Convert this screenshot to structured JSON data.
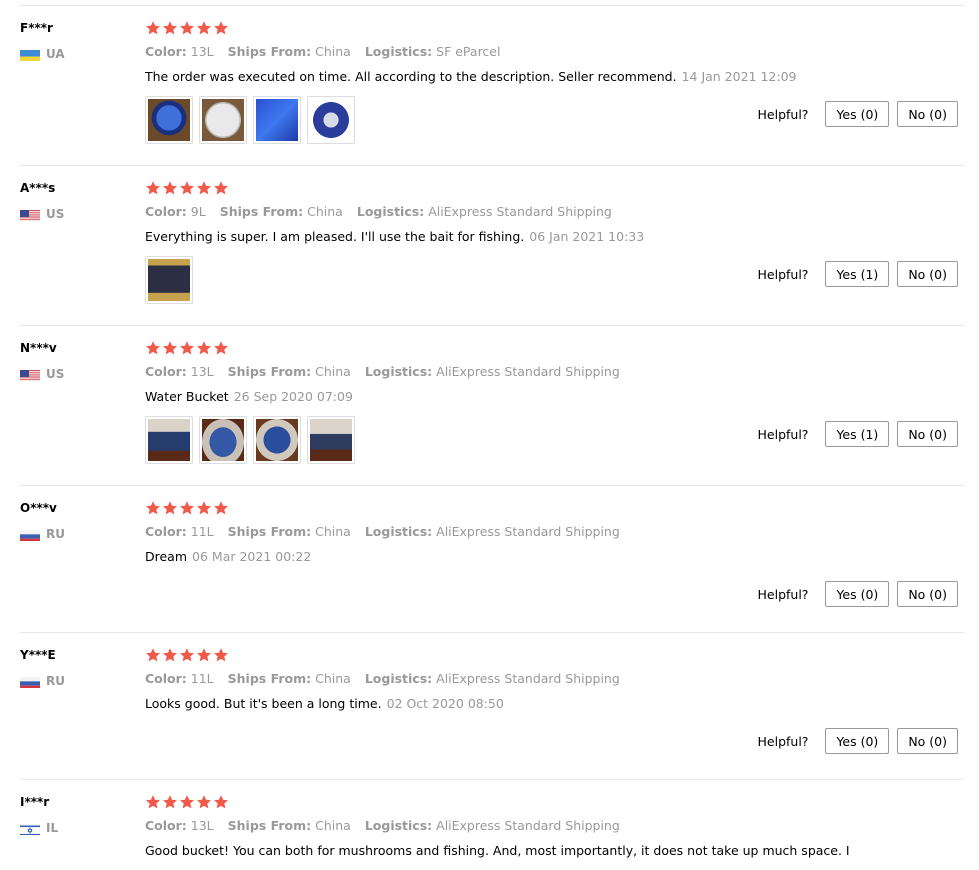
{
  "labels": {
    "color": "Color:",
    "ships_from": "Ships From:",
    "logistics": "Logistics:",
    "helpful": "Helpful?"
  },
  "colors": {
    "star": "#f05a4a",
    "meta_grey": "#999999",
    "border": "#e8e8e8"
  },
  "reviews": [
    {
      "user": "F***r",
      "country": "UA",
      "rating": 5,
      "color": "13L",
      "ships_from": "China",
      "logistics": "SF eParcel",
      "text": "The order was executed on time. All according to the description. Seller recommend.",
      "date": "14 Jan 2021 12:09",
      "yes": "Yes (0)",
      "no": "No (0)",
      "photos": [
        "blue-bucket-photo",
        "white-bucket-top-photo",
        "blue-bucket-flat-photo",
        "bucket-inside-photo"
      ]
    },
    {
      "user": "A***s",
      "country": "US",
      "rating": 5,
      "color": "9L",
      "ships_from": "China",
      "logistics": "AliExpress Standard Shipping",
      "text": "Everything is super. I am pleased. I'll use the bait for fishing.",
      "date": "06 Jan 2021 10:33",
      "yes": "Yes (1)",
      "no": "No (0)",
      "photos": [
        "bucket-on-table-photo"
      ]
    },
    {
      "user": "N***v",
      "country": "US",
      "rating": 5,
      "color": "13L",
      "ships_from": "China",
      "logistics": "AliExpress Standard Shipping",
      "text": "Water Bucket",
      "date": "26 Sep 2020 07:09",
      "yes": "Yes (1)",
      "no": "No (0)",
      "photos": [
        "bucket-side-photo",
        "bucket-folded-photo",
        "bucket-top-photo",
        "bucket-open-photo"
      ]
    },
    {
      "user": "O***v",
      "country": "RU",
      "rating": 5,
      "color": "11L",
      "ships_from": "China",
      "logistics": "AliExpress Standard Shipping",
      "text": "Dream",
      "date": "06 Mar 2021 00:22",
      "yes": "Yes (0)",
      "no": "No (0)",
      "photos": []
    },
    {
      "user": "Y***E",
      "country": "RU",
      "rating": 5,
      "color": "11L",
      "ships_from": "China",
      "logistics": "AliExpress Standard Shipping",
      "text": "Looks good. But it's been a long time.",
      "date": "02 Oct 2020 08:50",
      "yes": "Yes (0)",
      "no": "No (0)",
      "photos": []
    },
    {
      "user": "I***r",
      "country": "IL",
      "rating": 5,
      "color": "13L",
      "ships_from": "China",
      "logistics": "AliExpress Standard Shipping",
      "text": "Good bucket! You can both for mushrooms and fishing. And, most importantly, it does not take up much space. I",
      "date": "",
      "yes": "",
      "no": "",
      "photos": []
    }
  ]
}
